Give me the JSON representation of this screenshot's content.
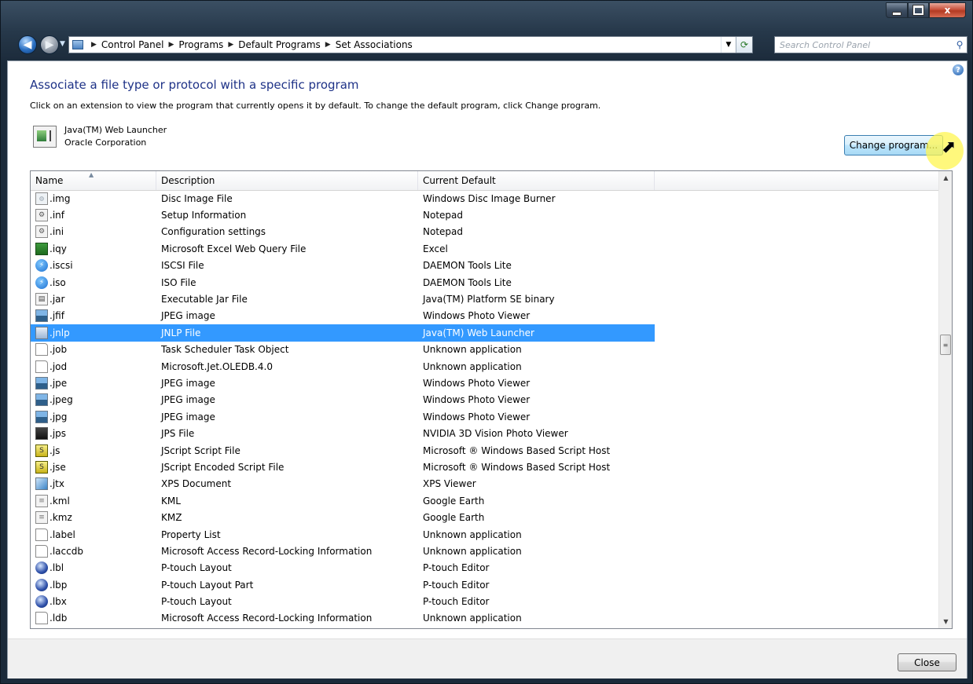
{
  "window": {
    "caption_buttons": {
      "minimize": "minimize",
      "maximize": "maximize",
      "close": "x"
    }
  },
  "nav": {
    "breadcrumb": [
      "Control Panel",
      "Programs",
      "Default Programs",
      "Set Associations"
    ],
    "search_placeholder": "Search Control Panel"
  },
  "page": {
    "heading": "Associate a file type or protocol with a specific program",
    "instructions": "Click on an extension to view the program that currently opens it by default. To change the default program, click Change program.",
    "program_name": "Java(TM) Web Launcher",
    "program_publisher": "Oracle Corporation",
    "change_button": "Change program...",
    "close_button": "Close"
  },
  "list": {
    "columns": [
      "Name",
      "Description",
      "Current Default"
    ],
    "selected_index": 8,
    "rows": [
      {
        "icon": "disc-icon",
        "name": ".img",
        "description": "Disc Image File",
        "default": "Windows Disc Image Burner"
      },
      {
        "icon": "gear-file-icon",
        "name": ".inf",
        "description": "Setup Information",
        "default": "Notepad"
      },
      {
        "icon": "gear-file-icon",
        "name": ".ini",
        "description": "Configuration settings",
        "default": "Notepad"
      },
      {
        "icon": "excel-query-icon",
        "name": ".iqy",
        "description": "Microsoft Excel Web Query File",
        "default": "Excel"
      },
      {
        "icon": "daemon-tools-icon",
        "name": ".iscsi",
        "description": "ISCSI File",
        "default": "DAEMON Tools Lite"
      },
      {
        "icon": "daemon-tools-icon",
        "name": ".iso",
        "description": "ISO File",
        "default": "DAEMON Tools Lite"
      },
      {
        "icon": "jar-file-icon",
        "name": ".jar",
        "description": "Executable Jar File",
        "default": "Java(TM) Platform SE binary"
      },
      {
        "icon": "photo-icon",
        "name": ".jfif",
        "description": "JPEG image",
        "default": "Windows Photo Viewer"
      },
      {
        "icon": "jnlp-icon",
        "name": ".jnlp",
        "description": "JNLP File",
        "default": "Java(TM) Web Launcher"
      },
      {
        "icon": "blank-file-icon",
        "name": ".job",
        "description": "Task Scheduler Task Object",
        "default": "Unknown application"
      },
      {
        "icon": "blank-file-icon",
        "name": ".jod",
        "description": "Microsoft.Jet.OLEDB.4.0",
        "default": "Unknown application"
      },
      {
        "icon": "photo-icon",
        "name": ".jpe",
        "description": "JPEG image",
        "default": "Windows Photo Viewer"
      },
      {
        "icon": "photo-icon",
        "name": ".jpeg",
        "description": "JPEG image",
        "default": "Windows Photo Viewer"
      },
      {
        "icon": "photo-icon",
        "name": ".jpg",
        "description": "JPEG image",
        "default": "Windows Photo Viewer"
      },
      {
        "icon": "jps-icon",
        "name": ".jps",
        "description": "JPS File",
        "default": "NVIDIA 3D Vision Photo Viewer"
      },
      {
        "icon": "script-icon",
        "name": ".js",
        "description": "JScript Script File",
        "default": "Microsoft ® Windows Based Script Host"
      },
      {
        "icon": "script-icon",
        "name": ".jse",
        "description": "JScript Encoded Script File",
        "default": "Microsoft ® Windows Based Script Host"
      },
      {
        "icon": "xps-icon",
        "name": ".jtx",
        "description": "XPS Document",
        "default": "XPS Viewer"
      },
      {
        "icon": "kml-icon",
        "name": ".kml",
        "description": "KML",
        "default": "Google Earth"
      },
      {
        "icon": "kml-icon",
        "name": ".kmz",
        "description": "KMZ",
        "default": "Google Earth"
      },
      {
        "icon": "blank-file-icon",
        "name": ".label",
        "description": "Property List",
        "default": "Unknown application"
      },
      {
        "icon": "blank-file-icon",
        "name": ".laccdb",
        "description": "Microsoft Access Record-Locking Information",
        "default": "Unknown application"
      },
      {
        "icon": "ptouch-icon",
        "name": ".lbl",
        "description": "P-touch Layout",
        "default": "P-touch Editor"
      },
      {
        "icon": "ptouch-icon",
        "name": ".lbp",
        "description": "P-touch Layout Part",
        "default": "P-touch Editor"
      },
      {
        "icon": "ptouch-icon",
        "name": ".lbx",
        "description": "P-touch Layout",
        "default": "P-touch Editor"
      },
      {
        "icon": "blank-file-icon",
        "name": ".ldb",
        "description": "Microsoft Access Record-Locking Information",
        "default": "Unknown application"
      }
    ]
  }
}
